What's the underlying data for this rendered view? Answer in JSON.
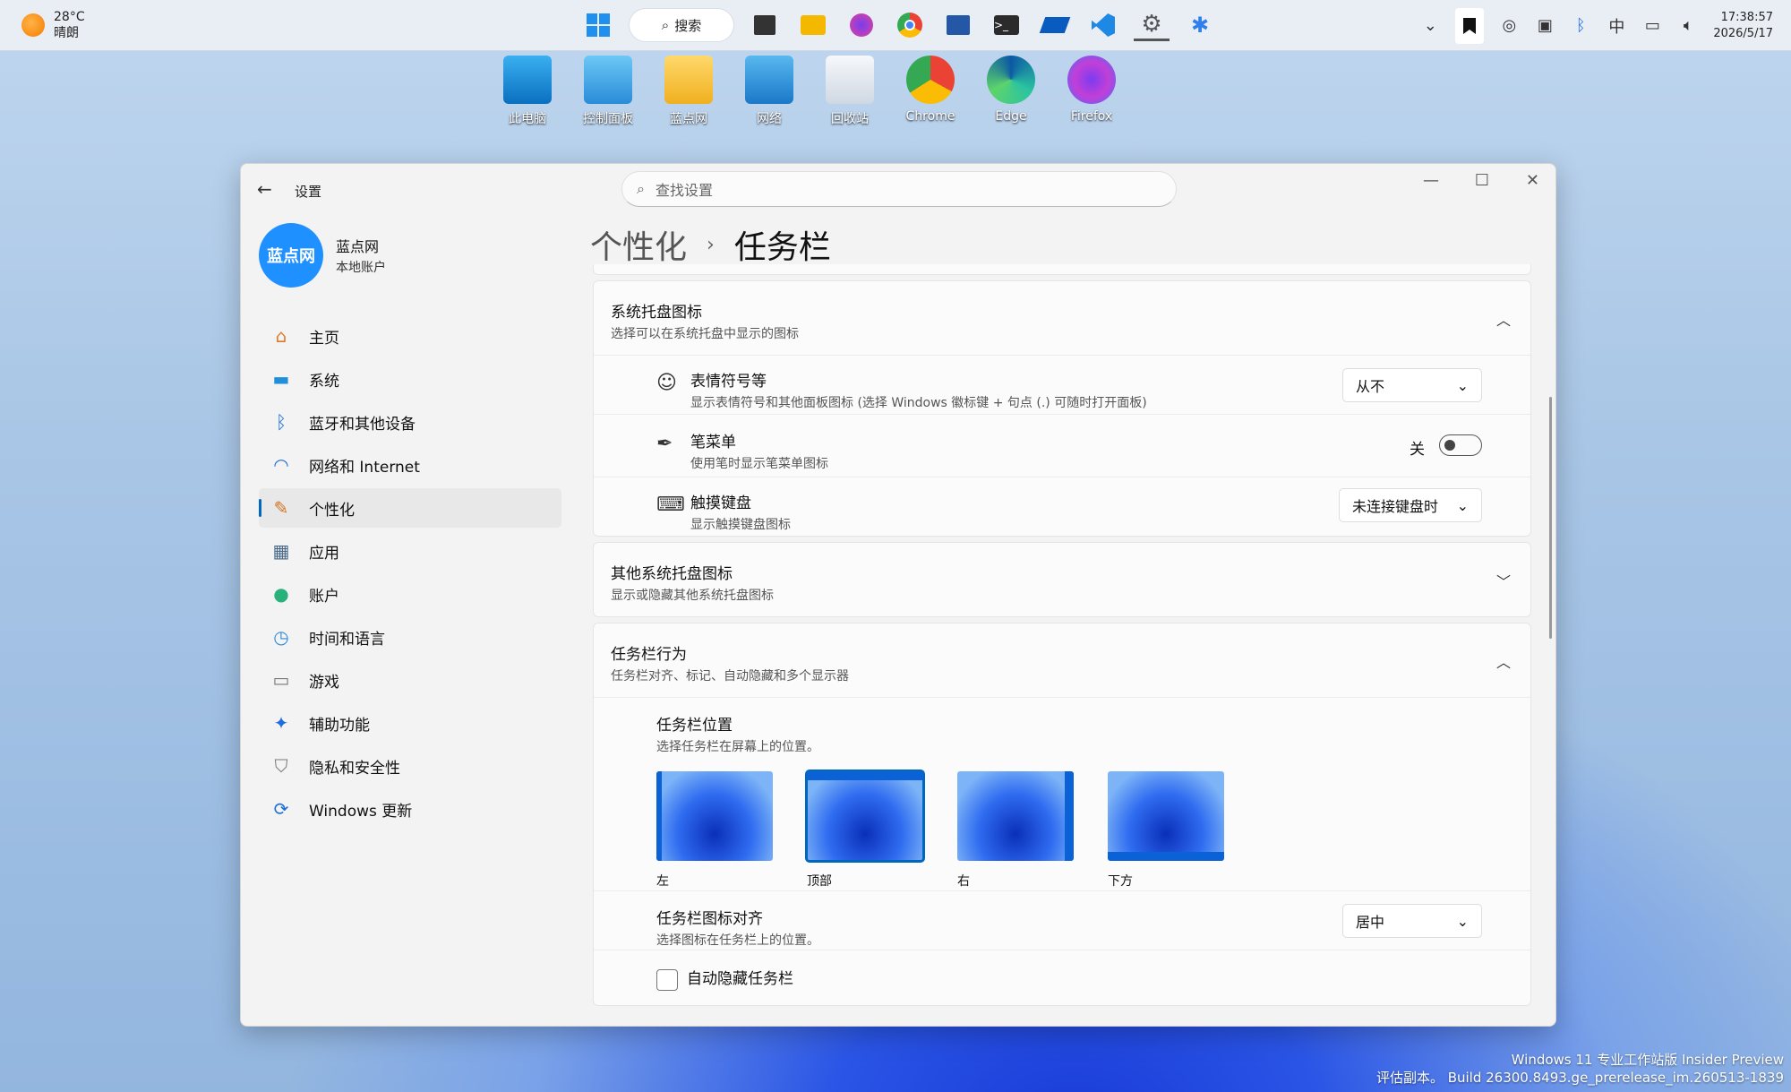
{
  "taskbar": {
    "weather_temp": "28°C",
    "weather_desc": "晴朗",
    "search_label": "搜索",
    "time": "17:38:57",
    "date": "2026/5/17",
    "ime": "中",
    "apps": [
      "windows-start-icon",
      "file-explorer-icon",
      "folder-icon",
      "firefox-icon",
      "chrome-icon",
      "remote-desktop-icon",
      "terminal-icon",
      "app-icon",
      "vscode-icon",
      "settings-gear-icon",
      "copilot-icon"
    ]
  },
  "desktop": [
    "此电脑",
    "控制面板",
    "蓝点网",
    "网络",
    "回收站",
    "Chrome",
    "Edge",
    "Firefox"
  ],
  "window": {
    "title": "设置",
    "search_placeholder": "查找设置",
    "user_name": "蓝点网",
    "user_type": "本地账户",
    "avatar_text": "蓝点网",
    "breadcrumb_parent": "个性化",
    "breadcrumb_current": "任务栏",
    "nav": [
      {
        "label": "主页",
        "icon": "home-icon"
      },
      {
        "label": "系统",
        "icon": "system-icon"
      },
      {
        "label": "蓝牙和其他设备",
        "icon": "bluetooth-icon"
      },
      {
        "label": "网络和 Internet",
        "icon": "wifi-icon"
      },
      {
        "label": "个性化",
        "icon": "brush-icon",
        "active": true
      },
      {
        "label": "应用",
        "icon": "apps-icon"
      },
      {
        "label": "账户",
        "icon": "account-icon"
      },
      {
        "label": "时间和语言",
        "icon": "time-language-icon"
      },
      {
        "label": "游戏",
        "icon": "gamepad-icon"
      },
      {
        "label": "辅助功能",
        "icon": "accessibility-icon"
      },
      {
        "label": "隐私和安全性",
        "icon": "shield-icon"
      },
      {
        "label": "Windows 更新",
        "icon": "update-icon"
      }
    ],
    "tray_section": {
      "title": "系统托盘图标",
      "subtitle": "选择可以在系统托盘中显示的图标"
    },
    "emoji": {
      "title": "表情符号等",
      "subtitle": "显示表情符号和其他面板图标 (选择 Windows 徽标键 + 句点 (.) 可随时打开面板)",
      "value": "从不"
    },
    "pen": {
      "title": "笔菜单",
      "subtitle": "使用笔时显示笔菜单图标",
      "state": "关"
    },
    "touch": {
      "title": "触摸键盘",
      "subtitle": "显示触摸键盘图标",
      "value": "未连接键盘时"
    },
    "other_section": {
      "title": "其他系统托盘图标",
      "subtitle": "显示或隐藏其他系统托盘图标"
    },
    "behavior_section": {
      "title": "任务栏行为",
      "subtitle": "任务栏对齐、标记、自动隐藏和多个显示器"
    },
    "position": {
      "title": "任务栏位置",
      "subtitle": "选择任务栏在屏幕上的位置。",
      "options": [
        "左",
        "顶部",
        "右",
        "下方"
      ],
      "selected": "顶部"
    },
    "align": {
      "title": "任务栏图标对齐",
      "subtitle": "选择图标在任务栏上的位置。",
      "value": "居中"
    },
    "autohide": {
      "label": "自动隐藏任务栏"
    }
  },
  "watermark": {
    "line1": "Windows 11 专业工作站版 Insider Preview",
    "line2": "评估副本。 Build 26300.8493.ge_prerelease_im.260513-1839"
  }
}
